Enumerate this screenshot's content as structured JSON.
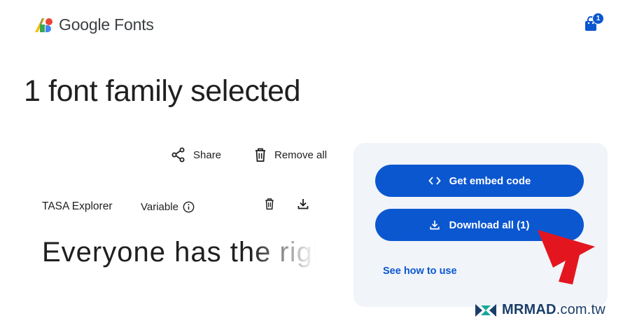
{
  "header": {
    "brand": "Google Fonts",
    "bag_count": "1",
    "logo_icon": "google-fonts-logo",
    "bag_icon": "shopping-bag-icon"
  },
  "page_title": "1 font family selected",
  "actions": {
    "share_label": "Share",
    "remove_all_label": "Remove all"
  },
  "font_row": {
    "name": "TASA Explorer",
    "variant": "Variable",
    "preview_text": "Everyone has the right to freedom"
  },
  "panel": {
    "embed_label": "Get embed code",
    "download_label": "Download all (1)",
    "how_to_label": "See how to use"
  },
  "watermark": {
    "brand": "MRMAD",
    "domain": ".com.tw"
  },
  "colors": {
    "accent": "#0b57d0",
    "panel_bg": "#f1f4f9",
    "annotation_arrow": "#e3161f"
  }
}
